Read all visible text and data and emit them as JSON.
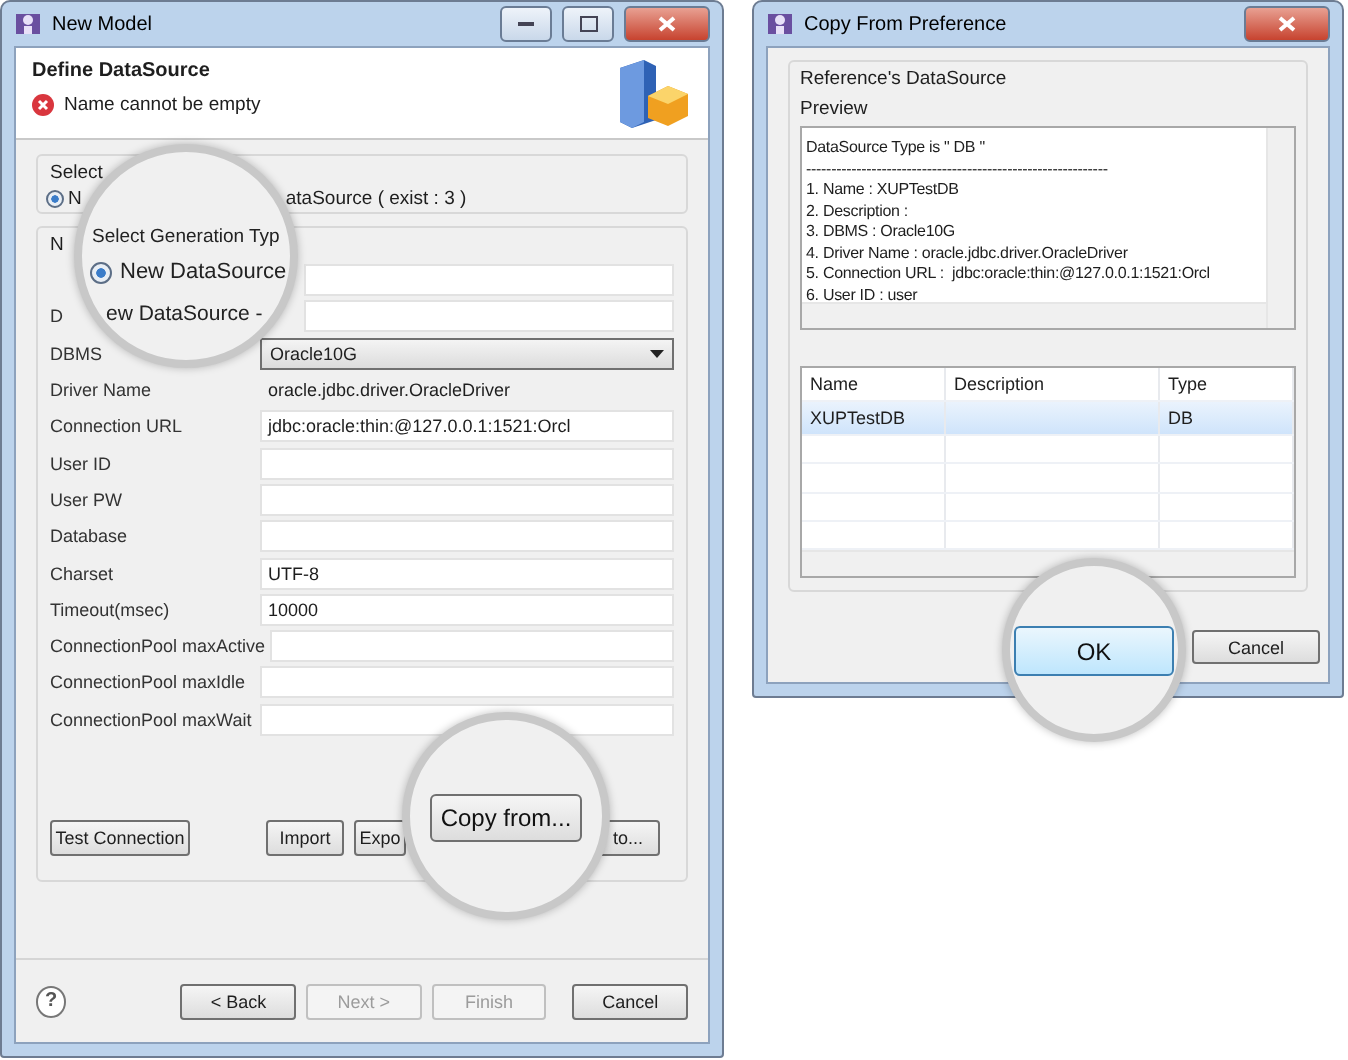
{
  "left_window": {
    "title": "New Model",
    "header": {
      "title": "Define DataSource",
      "error": "Name cannot be empty"
    },
    "generation_group": {
      "label": "Select",
      "radio": {
        "label": "N",
        "selected": true
      },
      "trailing": "ataSource ( exist : 3 )"
    },
    "datasource_group": {
      "label": "N",
      "fields": [
        {
          "kind": "text"
        },
        {
          "label": "D",
          "kind": "text"
        },
        {
          "label": "DBMS",
          "kind": "combo",
          "value": "Oracle10G"
        },
        {
          "label": "Driver Name",
          "kind": "readonly",
          "value": "oracle.jdbc.driver.OracleDriver"
        },
        {
          "label": "Connection URL",
          "kind": "text",
          "value": "jdbc:oracle:thin:@127.0.0.1:1521:Orcl"
        },
        {
          "label": "User ID",
          "kind": "text"
        },
        {
          "label": "User PW",
          "kind": "text"
        },
        {
          "label": "Database",
          "kind": "text"
        },
        {
          "label": "Charset",
          "kind": "text",
          "value": "UTF-8"
        },
        {
          "label": "Timeout(msec)",
          "kind": "text",
          "value": "10000"
        },
        {
          "label": "ConnectionPool maxActive",
          "kind": "text"
        },
        {
          "label": "ConnectionPool maxIdle",
          "kind": "text"
        },
        {
          "label": "ConnectionPool maxWait",
          "kind": "text"
        }
      ],
      "buttons": [
        {
          "label": "Test Connection"
        },
        {
          "label": "Import"
        },
        {
          "label": "Expo"
        },
        {
          "label": "to..."
        }
      ]
    },
    "footer": {
      "help": "?",
      "buttons": [
        {
          "label": "< Back",
          "disabled": false
        },
        {
          "label": "Next >",
          "disabled": true
        },
        {
          "label": "Finish",
          "disabled": true
        },
        {
          "label": "Cancel",
          "disabled": false
        }
      ]
    }
  },
  "right_window": {
    "title": "Copy From Preference",
    "group_label": "Reference's DataSource",
    "preview_label": "Preview",
    "preview_lines": [
      "DataSource Type is \" DB \"",
      "------------------------------------------------------------",
      "1. Name : XUPTestDB",
      "2. Description :",
      "3. DBMS : Oracle10G",
      "4. Driver Name : oracle.jdbc.driver.OracleDriver",
      "5. Connection URL :  jdbc:oracle:thin:@127.0.0.1:1521:Orcl",
      "6. User ID : user"
    ],
    "table": {
      "columns": [
        "Name",
        "Description",
        "Type"
      ],
      "rows": [
        {
          "name": "XUPTestDB",
          "type": "DB",
          "selected": true
        }
      ]
    },
    "buttons": [
      {
        "label": "Cancel"
      }
    ]
  },
  "magnifiers": [
    {
      "title": "Select Generation Typ",
      "radio_label": "New DataSource",
      "radio_selected": true,
      "subtitle": "ew DataSource -"
    },
    {
      "button": "Copy from..."
    },
    {
      "button": "OK"
    }
  ]
}
